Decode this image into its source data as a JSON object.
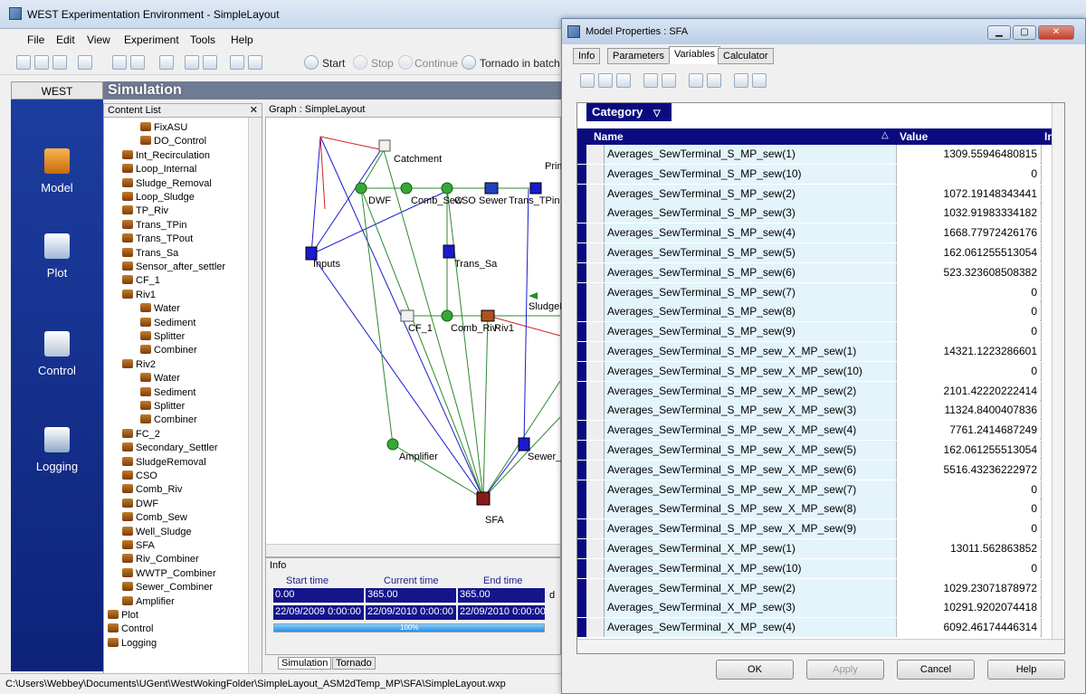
{
  "main_window": {
    "title": "WEST Experimentation Environment - SimpleLayout"
  },
  "menu": [
    "File",
    "Edit",
    "View",
    "Experiment",
    "Tools",
    "Help"
  ],
  "toolbar": {
    "start": "Start",
    "stop": "Stop",
    "continue": "Continue",
    "tornado": "Tornado in batch"
  },
  "west_bar": {
    "header": "WEST",
    "items": [
      "Model",
      "Plot",
      "Control",
      "Logging"
    ]
  },
  "simulation_header": "Simulation",
  "content_list": {
    "title": "Content List",
    "items": [
      "FixASU",
      "DO_Control",
      "Int_Recirculation",
      "Loop_Internal",
      "Sludge_Removal",
      "Loop_Sludge",
      "TP_Riv",
      "Trans_TPin",
      "Trans_TPout",
      "Trans_Sa",
      "Sensor_after_settler",
      "CF_1",
      "Riv1",
      "Water",
      "Sediment",
      "Splitter",
      "Combiner",
      "Riv2",
      "Water",
      "Sediment",
      "Splitter",
      "Combiner",
      "FC_2",
      "Secondary_Settler",
      "SludgeRemoval",
      "CSO",
      "Comb_Riv",
      "DWF",
      "Comb_Sew",
      "Well_Sludge",
      "SFA",
      "Riv_Combiner",
      "WWTP_Combiner",
      "Sewer_Combiner",
      "Amplifier",
      "Plot",
      "Control",
      "Logging"
    ]
  },
  "graph": {
    "title": "Graph : SimpleLayout",
    "nodes": [
      "Catchment",
      "DWF",
      "Comb_Sew",
      "CSO",
      "Sewer",
      "Trans_TPin",
      "Prim",
      "Inputs",
      "Trans_Sa",
      "CF_1",
      "Comb_Riv",
      "Riv1",
      "SludgeR",
      "Amplifier",
      "Sewer_",
      "SFA"
    ]
  },
  "info": {
    "title": "Info",
    "start_time_label": "Start time",
    "current_time_label": "Current time",
    "end_time_label": "End time",
    "start_time": "0.00",
    "current_time": "365.00",
    "end_time": "365.00",
    "unit": "d",
    "start_date": "22/09/2009 0:00:00",
    "current_date": "22/09/2010 0:00:00",
    "end_date": "22/09/2010 0:00:00",
    "progress_label": "100%",
    "progress": 1.0
  },
  "bottom_tabs": [
    "Simulation",
    "Tornado"
  ],
  "status_path": "C:\\Users\\Webbey\\Documents\\UGent\\WestWokingFolder\\SimpleLayout_ASM2dTemp_MP\\SFA\\SimpleLayout.wxp",
  "dialog": {
    "title": "Model Properties : SFA",
    "tabs": [
      "Info",
      "Parameters",
      "Variables",
      "Calculator"
    ],
    "active_tab": "Variables",
    "category_label": "Category",
    "columns": [
      "Name",
      "Value",
      "Ini"
    ],
    "rows": [
      [
        "Averages_SewTerminal_S_MP_sew(1)",
        "1309.55946480815"
      ],
      [
        "Averages_SewTerminal_S_MP_sew(10)",
        "0"
      ],
      [
        "Averages_SewTerminal_S_MP_sew(2)",
        "1072.19148343441"
      ],
      [
        "Averages_SewTerminal_S_MP_sew(3)",
        "1032.91983334182"
      ],
      [
        "Averages_SewTerminal_S_MP_sew(4)",
        "1668.77972426176"
      ],
      [
        "Averages_SewTerminal_S_MP_sew(5)",
        "162.061255513054"
      ],
      [
        "Averages_SewTerminal_S_MP_sew(6)",
        "523.323608508382"
      ],
      [
        "Averages_SewTerminal_S_MP_sew(7)",
        "0"
      ],
      [
        "Averages_SewTerminal_S_MP_sew(8)",
        "0"
      ],
      [
        "Averages_SewTerminal_S_MP_sew(9)",
        "0"
      ],
      [
        "Averages_SewTerminal_S_MP_sew_X_MP_sew(1)",
        "14321.1223286601"
      ],
      [
        "Averages_SewTerminal_S_MP_sew_X_MP_sew(10)",
        "0"
      ],
      [
        "Averages_SewTerminal_S_MP_sew_X_MP_sew(2)",
        "2101.42220222414"
      ],
      [
        "Averages_SewTerminal_S_MP_sew_X_MP_sew(3)",
        "11324.8400407836"
      ],
      [
        "Averages_SewTerminal_S_MP_sew_X_MP_sew(4)",
        "7761.2414687249"
      ],
      [
        "Averages_SewTerminal_S_MP_sew_X_MP_sew(5)",
        "162.061255513054"
      ],
      [
        "Averages_SewTerminal_S_MP_sew_X_MP_sew(6)",
        "5516.43236222972"
      ],
      [
        "Averages_SewTerminal_S_MP_sew_X_MP_sew(7)",
        "0"
      ],
      [
        "Averages_SewTerminal_S_MP_sew_X_MP_sew(8)",
        "0"
      ],
      [
        "Averages_SewTerminal_S_MP_sew_X_MP_sew(9)",
        "0"
      ],
      [
        "Averages_SewTerminal_X_MP_sew(1)",
        "13011.562863852"
      ],
      [
        "Averages_SewTerminal_X_MP_sew(10)",
        "0"
      ],
      [
        "Averages_SewTerminal_X_MP_sew(2)",
        "1029.23071878972"
      ],
      [
        "Averages_SewTerminal_X_MP_sew(3)",
        "10291.9202074418"
      ],
      [
        "Averages_SewTerminal_X_MP_sew(4)",
        "6092.46174446314"
      ]
    ],
    "buttons": {
      "ok": "OK",
      "apply": "Apply",
      "cancel": "Cancel",
      "help": "Help"
    }
  },
  "colors": {
    "accent": "#0b0b80",
    "grid_name_bg": "#e3f4fb",
    "west_bar": "#1d3ea0"
  }
}
